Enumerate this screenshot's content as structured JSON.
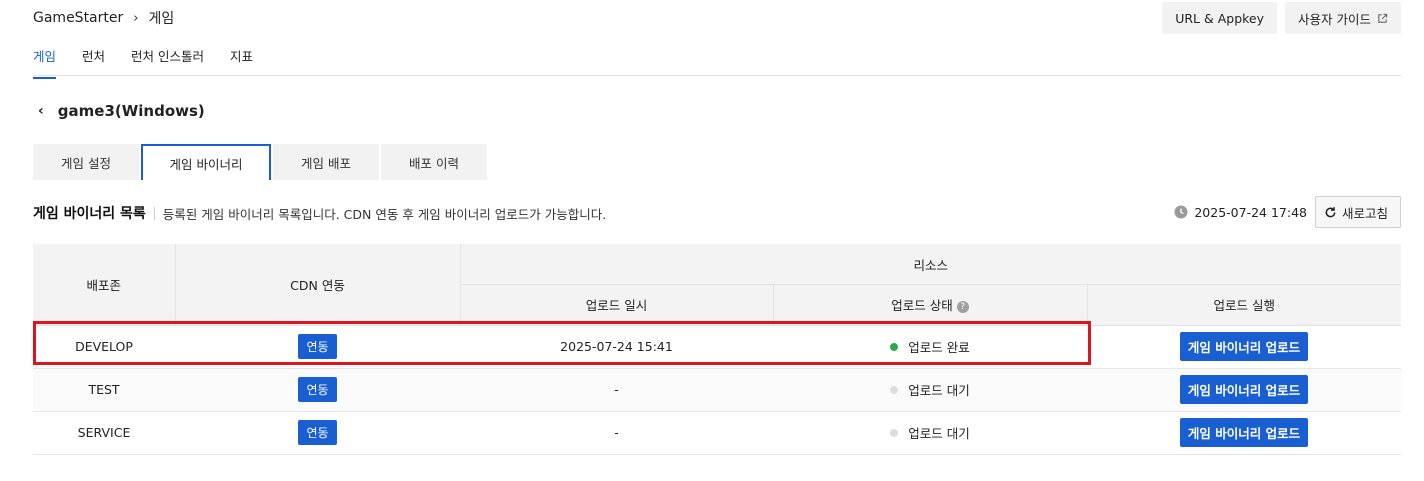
{
  "breadcrumb": {
    "root": "GameStarter",
    "current": "게임"
  },
  "top_actions": {
    "appkey_label": "URL & Appkey",
    "guide_label": "사용자 가이드"
  },
  "nav_tabs": [
    {
      "label": "게임",
      "active": true
    },
    {
      "label": "런처",
      "active": false
    },
    {
      "label": "런처 인스톨러",
      "active": false
    },
    {
      "label": "지표",
      "active": false
    }
  ],
  "game_title": "game3(Windows)",
  "sub_tabs": [
    {
      "label": "게임 설정",
      "active": false
    },
    {
      "label": "게임 바이너리",
      "active": true
    },
    {
      "label": "게임 배포",
      "active": false
    },
    {
      "label": "배포 이력",
      "active": false
    }
  ],
  "section": {
    "title": "게임 바이너리 목록",
    "description": "등록된 게임 바이너리 목록입니다. CDN 연동 후 게임 바이너리 업로드가 가능합니다."
  },
  "refresh": {
    "timestamp": "2025-07-24 17:48",
    "label": "새로고침"
  },
  "table": {
    "headers": {
      "zone": "배포존",
      "cdn": "CDN 연동",
      "resource": "리소스",
      "upload_time": "업로드 일시",
      "upload_status": "업로드 상태",
      "upload_run": "업로드 실행"
    },
    "rows": [
      {
        "zone": "DEVELOP",
        "cdn": "연동",
        "upload_time": "2025-07-24 15:41",
        "status": "업로드 완료",
        "status_color": "#2aa84a",
        "action": "게임 바이너리 업로드"
      },
      {
        "zone": "TEST",
        "cdn": "연동",
        "upload_time": "-",
        "status": "업로드 대기",
        "status_color": "#dddddd",
        "action": "게임 바이너리 업로드"
      },
      {
        "zone": "SERVICE",
        "cdn": "연동",
        "upload_time": "-",
        "status": "업로드 대기",
        "status_color": "#dddddd",
        "action": "게임 바이너리 업로드"
      }
    ]
  },
  "colors": {
    "accent": "#1a5fd1",
    "highlight": "#e0141c"
  }
}
